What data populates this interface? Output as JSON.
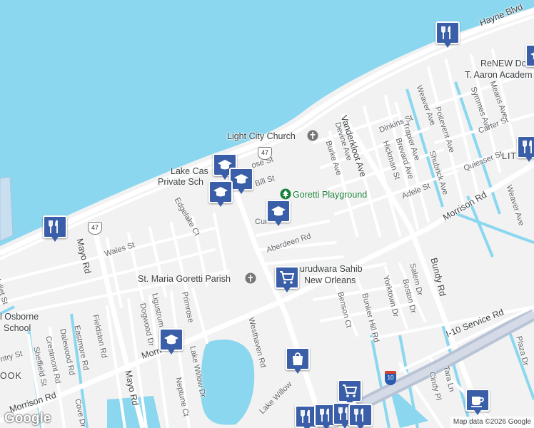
{
  "map": {
    "colors": {
      "water": "#8ad7ef",
      "land": "#f2f2f2",
      "road": "#ffffff",
      "highway": "#b8c4d6",
      "marker": "#3a5fa8",
      "park": "#188038"
    },
    "streets": [
      {
        "id": "hayne-blvd",
        "text": "Hayne Blvd"
      },
      {
        "id": "renew",
        "text": "ReNEW Dol"
      },
      {
        "id": "aaron",
        "text": "T. Aaron Academ"
      },
      {
        "id": "weaver-ave",
        "text": "Weaver Ave"
      },
      {
        "id": "symmes-ave",
        "text": "Symmes Ave"
      },
      {
        "id": "means-ave",
        "text": "Means Ave"
      },
      {
        "id": "carter-st",
        "text": "Carter St"
      },
      {
        "id": "dinkins-st",
        "text": "Dinkins St"
      },
      {
        "id": "trapier-ave",
        "text": "Trapier Ave"
      },
      {
        "id": "poitevent-ave",
        "text": "Poitevent Ave"
      },
      {
        "id": "quiesser-st",
        "text": "Quiesser St"
      },
      {
        "id": "lit",
        "text": "LIT"
      },
      {
        "id": "vanderkloot-ave",
        "text": "Vanderkloot Ave"
      },
      {
        "id": "devine-ave",
        "text": "Devine Ave"
      },
      {
        "id": "burke-ave",
        "text": "Burke Ave"
      },
      {
        "id": "hickman-st",
        "text": "Hickman St"
      },
      {
        "id": "brevard-ave",
        "text": "Brevard Ave"
      },
      {
        "id": "shubrick-ave",
        "text": "Shubrick Ave"
      },
      {
        "id": "adele-st",
        "text": "Adele St"
      },
      {
        "id": "weaver-ave-2",
        "text": "Weaver Ave"
      },
      {
        "id": "morrison-rd-e",
        "text": "Morrison Rd"
      },
      {
        "id": "lake-cas",
        "text": "Lake Cas"
      },
      {
        "id": "private-sch",
        "text": "Private Sch"
      },
      {
        "id": "rose-st",
        "text": "ose St"
      },
      {
        "id": "bill-st",
        "text": "Bill St"
      },
      {
        "id": "edgelake-ct",
        "text": "Edgelake Ct"
      },
      {
        "id": "cur",
        "text": "Cur"
      },
      {
        "id": "aberdeen-rd",
        "text": "Aberdeen Rd"
      },
      {
        "id": "mayo-rd-n",
        "text": "Mayo Rd"
      },
      {
        "id": "wales-st",
        "text": "Wales St"
      },
      {
        "id": "mullet-st",
        "text": "Mullet St"
      },
      {
        "id": "osborne",
        "text": "l Osborne"
      },
      {
        "id": "school",
        "text": "School"
      },
      {
        "id": "fieldston-rd",
        "text": "Fieldston Rd"
      },
      {
        "id": "eastmore-rd",
        "text": "Eastmore Rd"
      },
      {
        "id": "dalewood-rd",
        "text": "Dalewood Rd"
      },
      {
        "id": "crestmont-rd",
        "text": "Crestmont Rd"
      },
      {
        "id": "sheffield-st",
        "text": "Sheffield St"
      },
      {
        "id": "ntry-st",
        "text": "ntry St"
      },
      {
        "id": "ook",
        "text": "OOK"
      },
      {
        "id": "morrison-rd-w",
        "text": "Morrison Rd"
      },
      {
        "id": "morri",
        "text": "Morri"
      },
      {
        "id": "mayo-rd-s",
        "text": "Mayo Rd"
      },
      {
        "id": "ligustrum",
        "text": "Ligustrum Dr"
      },
      {
        "id": "dogwood-dr",
        "text": "Dogwood Dr"
      },
      {
        "id": "primrose",
        "text": "Primrose"
      },
      {
        "id": "lake-willow-dr",
        "text": "Lake Willow Dr"
      },
      {
        "id": "neptune-ct",
        "text": "Neptune Ct"
      },
      {
        "id": "cove-dr",
        "text": "Cove Dr"
      },
      {
        "id": "westhaven-rd",
        "text": "Westhaven Rd"
      },
      {
        "id": "lake-willow",
        "text": "Lake Willow"
      },
      {
        "id": "benson-ct",
        "text": "Benson Ct"
      },
      {
        "id": "bunker-hill-rd",
        "text": "Bunker Hill Rd"
      },
      {
        "id": "yorktown-dr",
        "text": "Yorktown Dr"
      },
      {
        "id": "boston-dr",
        "text": "Boston Dr"
      },
      {
        "id": "salem-dr",
        "text": "Salem Dr"
      },
      {
        "id": "bundy-rd",
        "text": "Bundy Rd"
      },
      {
        "id": "i10-service",
        "text": "I-10 Service Rd"
      },
      {
        "id": "plaza-dr",
        "text": "Plaza Dr"
      },
      {
        "id": "tara-ln",
        "text": "Tara Ln"
      },
      {
        "id": "cindy-pl",
        "text": "Cindy Pl"
      }
    ],
    "places": [
      {
        "id": "light-city-church",
        "text": "Light City Church",
        "icon": "church-icon"
      },
      {
        "id": "goretti-playground",
        "text": "Goretti Playground",
        "icon": "park-tree-icon"
      },
      {
        "id": "st-maria-goretti",
        "text": "St. Maria Goretti Parish",
        "icon": "church-icon"
      },
      {
        "id": "gurudwara-1",
        "text": "urudwara Sahib"
      },
      {
        "id": "gurudwara-2",
        "text": "New Orleans"
      }
    ],
    "shields": {
      "route_47": "47",
      "i10": "10"
    },
    "markers": [
      {
        "id": "restaurant-1",
        "icon": "restaurant-icon"
      },
      {
        "id": "restaurant-2",
        "icon": "restaurant-icon"
      },
      {
        "id": "restaurant-3",
        "icon": "restaurant-icon"
      },
      {
        "id": "school-1",
        "icon": "school-icon"
      },
      {
        "id": "school-2",
        "icon": "school-icon"
      },
      {
        "id": "school-3",
        "icon": "school-icon"
      },
      {
        "id": "school-4",
        "icon": "school-icon"
      },
      {
        "id": "school-5",
        "icon": "school-icon"
      },
      {
        "id": "grocery",
        "icon": "shopping-cart-icon"
      },
      {
        "id": "shopping",
        "icon": "shopping-bag-icon"
      },
      {
        "id": "cafe",
        "icon": "coffee-cup-icon"
      }
    ],
    "branding": {
      "logo": "Google",
      "attribution": "Map data ©2026 Google"
    }
  }
}
